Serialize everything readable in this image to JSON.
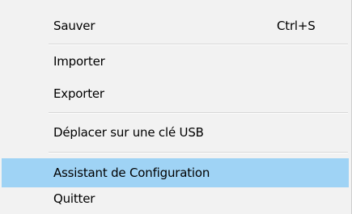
{
  "menu": {
    "items": [
      {
        "label": "Sauver",
        "shortcut": "Ctrl+S"
      },
      {
        "label": "Importer"
      },
      {
        "label": "Exporter"
      },
      {
        "label": "Déplacer sur une clé USB"
      },
      {
        "label": "Assistant de Configuration",
        "highlighted": true
      },
      {
        "label": "Quitter"
      }
    ]
  },
  "colors": {
    "menu_background": "#f2f2f2",
    "highlight": "#9fd3f5",
    "separator": "#d7d7d7"
  }
}
